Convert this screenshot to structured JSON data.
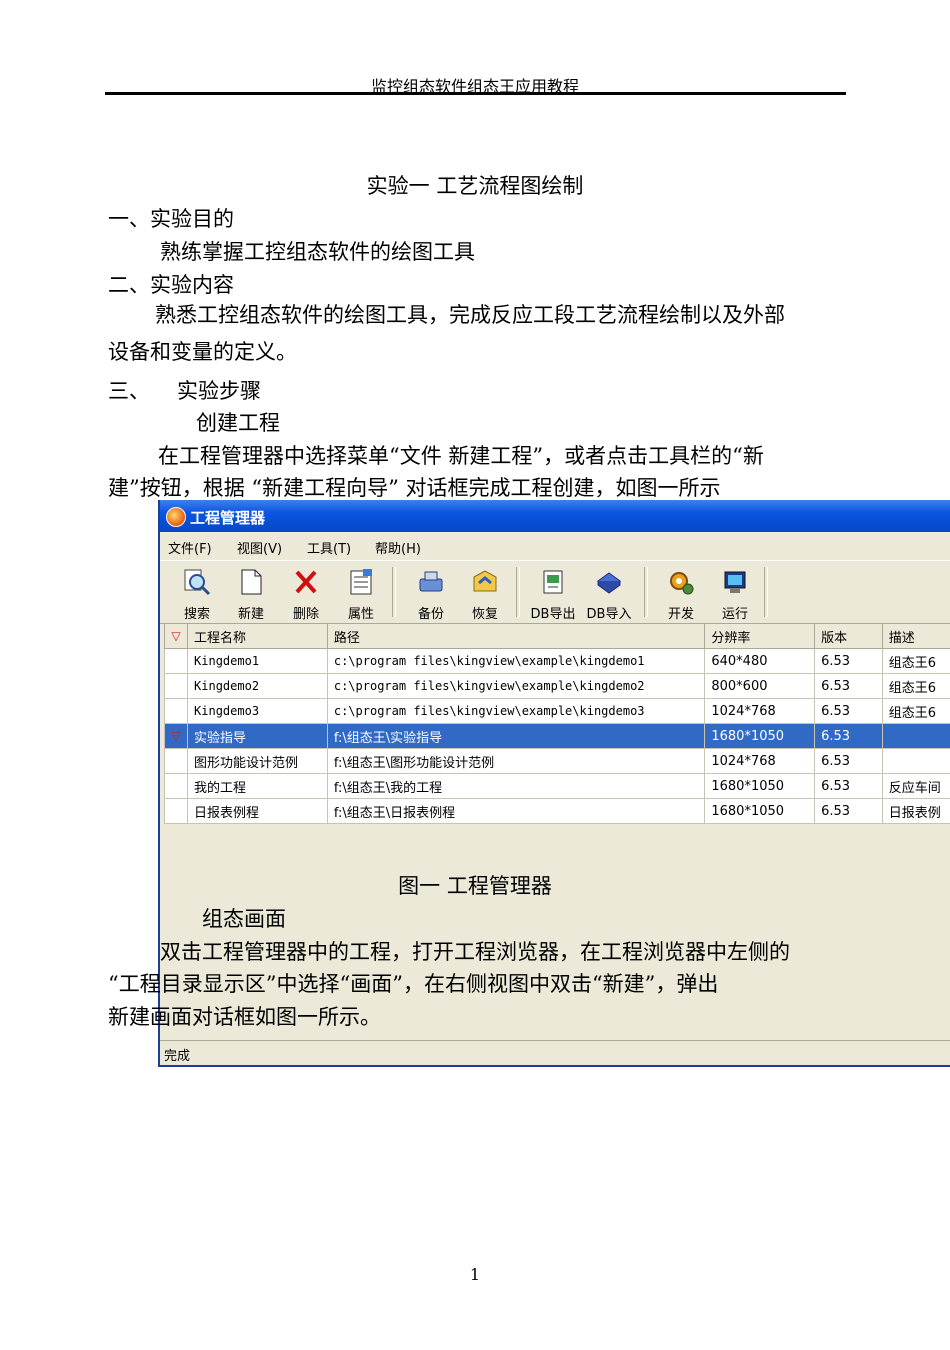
{
  "header": {
    "running_title": "监控组态软件组态王应用教程"
  },
  "doc": {
    "title": "实验一    工艺流程图绘制",
    "s1_heading": "一、实验目的",
    "s1_body": "熟练掌握工控组态软件的绘图工具",
    "s2_heading": "二、实验内容",
    "s2_body_line1": "熟悉工控组态软件的绘图工具，完成反应工段工艺流程绘制以及外部",
    "s2_body_line2": "设备和变量的定义。",
    "s3_num": "三、",
    "s3_heading": "实验步骤",
    "step1_heading": "创建工程",
    "step1_line1": "在工程管理器中选择菜单“文件  新建工程”，或者点击工具栏的“新",
    "step1_line2": "建”按钮，根据  “新建工程向导”  对话框完成工程创建，如图一所示",
    "figure_caption": "图一  工程管理器",
    "step2_heading": "组态画面",
    "step2_line1": "双击工程管理器中的工程，打开工程浏览器，在工程浏览器中左侧的",
    "step2_line2": "“工程目录显示区”中选择“画面”，在右侧视图中双击“新建”，弹出",
    "step2_line3": "新建画面对话框如图一所示。",
    "page_number": "1"
  },
  "window": {
    "title": "工程管理器",
    "menu": [
      "文件(F)",
      "视图(V)",
      "工具(T)",
      "帮助(H)"
    ],
    "toolbar": [
      {
        "label": "搜索",
        "icon": "search-icon"
      },
      {
        "label": "新建",
        "icon": "new-file-icon"
      },
      {
        "label": "删除",
        "icon": "delete-icon"
      },
      {
        "label": "属性",
        "icon": "properties-icon"
      },
      {
        "label": "备份",
        "icon": "backup-icon"
      },
      {
        "label": "恢复",
        "icon": "restore-icon"
      },
      {
        "label": "DB导出",
        "icon": "db-export-icon"
      },
      {
        "label": "DB导入",
        "icon": "db-import-icon"
      },
      {
        "label": "开发",
        "icon": "develop-icon"
      },
      {
        "label": "运行",
        "icon": "run-icon"
      }
    ],
    "columns": [
      "工程名称",
      "路径",
      "分辨率",
      "版本",
      "描述"
    ],
    "rows": [
      {
        "name": "Kingdemo1",
        "path": "c:\\program files\\kingview\\example\\kingdemo1",
        "res": "640*480",
        "ver": "6.53",
        "desc": "组态王6"
      },
      {
        "name": "Kingdemo2",
        "path": "c:\\program files\\kingview\\example\\kingdemo2",
        "res": "800*600",
        "ver": "6.53",
        "desc": "组态王6"
      },
      {
        "name": "Kingdemo3",
        "path": "c:\\program files\\kingview\\example\\kingdemo3",
        "res": "1024*768",
        "ver": "6.53",
        "desc": "组态王6"
      },
      {
        "name": "实验指导",
        "path": "f:\\组态王\\实验指导",
        "res": "1680*1050",
        "ver": "6.53",
        "desc": ""
      },
      {
        "name": "图形功能设计范例",
        "path": "f:\\组态王\\图形功能设计范例",
        "res": "1024*768",
        "ver": "6.53",
        "desc": ""
      },
      {
        "name": "我的工程",
        "path": "f:\\组态王\\我的工程",
        "res": "1680*1050",
        "ver": "6.53",
        "desc": "反应车间"
      },
      {
        "name": "日报表例程",
        "path": "f:\\组态王\\日报表例程",
        "res": "1680*1050",
        "ver": "6.53",
        "desc": "日报表例"
      }
    ],
    "status": "完成"
  }
}
